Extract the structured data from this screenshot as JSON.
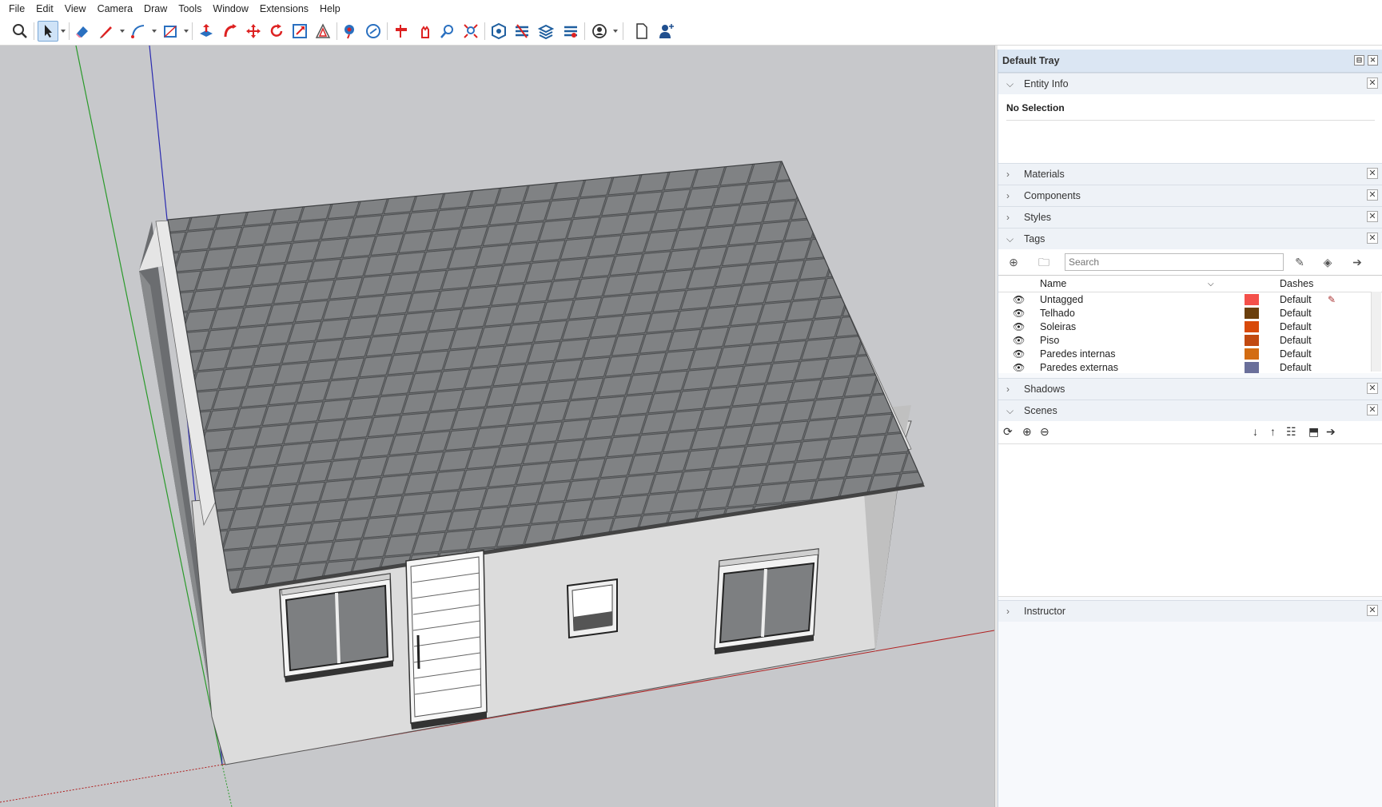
{
  "menu": [
    "File",
    "Edit",
    "View",
    "Camera",
    "Draw",
    "Tools",
    "Window",
    "Extensions",
    "Help"
  ],
  "toolbar": {
    "icons": [
      "search-icon",
      "select-arrow-icon",
      "eraser-icon",
      "pencil-line-icon",
      "arc-icon",
      "rectangle-icon",
      "push-pull-icon",
      "follow-me-icon",
      "move-icon",
      "rotate-icon",
      "scale-icon",
      "offset-icon",
      "tape-measure-icon",
      "text-label-icon",
      "section-plane-icon",
      "walk-icon",
      "zoom-icon",
      "zoom-extents-icon",
      "warehouse-icon",
      "extension-warehouse-icon",
      "layout-send-icon",
      "extension-manager-icon",
      "profile-icon",
      "new-file-icon",
      "add-user-icon"
    ]
  },
  "tray": {
    "title": "Default Tray",
    "entity_info": {
      "label": "Entity Info",
      "selection": "No Selection"
    },
    "panels": {
      "materials": "Materials",
      "components": "Components",
      "styles": "Styles",
      "tags": "Tags",
      "shadows": "Shadows",
      "scenes": "Scenes",
      "instructor": "Instructor"
    },
    "tags_search_placeholder": "Search",
    "tags_columns": {
      "name": "Name",
      "dashes": "Dashes"
    },
    "tags": [
      {
        "name": "Untagged",
        "color": "#f4504a",
        "dashes": "Default"
      },
      {
        "name": "Telhado",
        "color": "#6b3f0c",
        "dashes": "Default"
      },
      {
        "name": "Soleiras",
        "color": "#d84a0a",
        "dashes": "Default"
      },
      {
        "name": "Piso",
        "color": "#c24a10",
        "dashes": "Default"
      },
      {
        "name": "Paredes internas",
        "color": "#d36c12",
        "dashes": "Default"
      },
      {
        "name": "Paredes externas",
        "color": "#6a6f9a",
        "dashes": "Default"
      }
    ]
  }
}
